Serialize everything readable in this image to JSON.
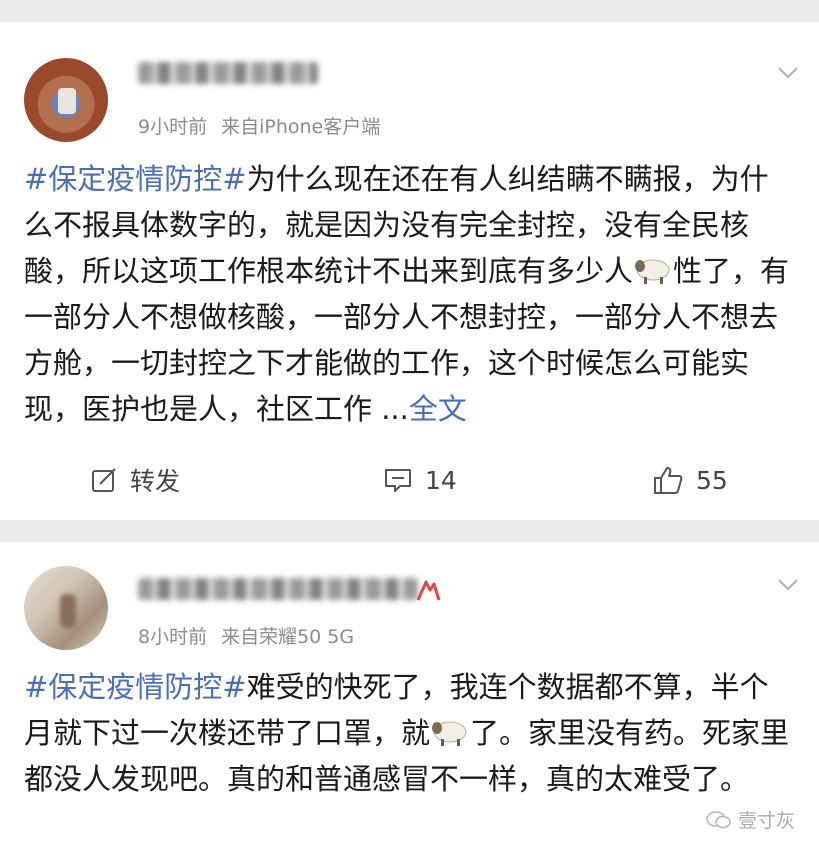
{
  "posts": [
    {
      "time": "9小时前",
      "source": "来自iPhone客户端",
      "hashtag": "#保定疫情防控#",
      "text_1": "为什么现在还在有人纠结瞒不瞒报，为什么不报具体数字的，就是因为没有完全封控，没有全民核酸，所以这项工作根本统计不出来到底有多少人",
      "text_2": "性了，有一部分人不想做核酸，一部分人不想封控，一部分人不想去方舱，一切封控之下才能做的工作，这个时候怎么可能实现，医护也是人，社区工作 ...",
      "more_label": "全文",
      "repost_label": "转发",
      "comment_count": "14",
      "like_count": "55"
    },
    {
      "time": "8小时前",
      "source": "来自荣耀50 5G",
      "hashtag": "#保定疫情防控#",
      "text_1": "难受的快死了，我连个数据都不算，半个月就下过一次楼还带了口罩，就",
      "text_2": "了。家里没有药。死家里都没人发现吧。真的和普通感冒不一样，真的太难受了。"
    }
  ],
  "watermark": "壹寸灰",
  "icons": {
    "sheep": "sheep-emoji-icon",
    "chevron": "chevron-down-icon",
    "repost": "repost-icon",
    "comment": "comment-icon",
    "like": "like-icon"
  },
  "colors": {
    "accent": "#4a6fb5",
    "separator": "#ebebeb"
  }
}
